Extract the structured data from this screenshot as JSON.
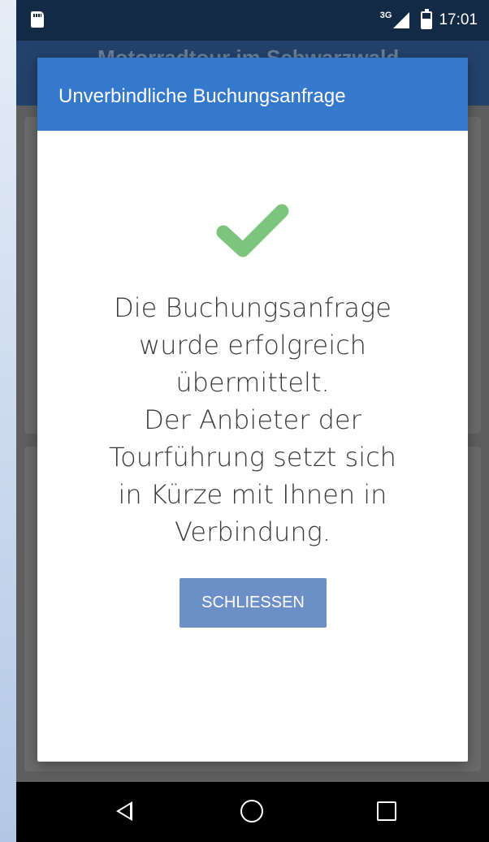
{
  "status_bar": {
    "network_type": "3G",
    "time": "17:01",
    "icons": [
      "sd-card-icon",
      "signal-icon",
      "battery-charging-icon"
    ]
  },
  "app_bar": {
    "title": "Motorradtour im Schwarzwald"
  },
  "dialog": {
    "title": "Unverbindliche Buchungsanfrage",
    "icon": "checkmark-icon",
    "icon_color": "#7dc47f",
    "header_color": "#3479cc",
    "message_lines": [
      "Die Buchungsanfrage",
      "wurde erfolgreich",
      "übermittelt.",
      "Der Anbieter der",
      "Tourführung setzt sich",
      "in Kürze mit Ihnen in",
      "Verbindung."
    ],
    "close_label": "SCHLIESSEN",
    "button_color": "#6d8fc8"
  },
  "nav_bar": {
    "icons": [
      "back-icon",
      "home-icon",
      "recents-icon"
    ]
  }
}
